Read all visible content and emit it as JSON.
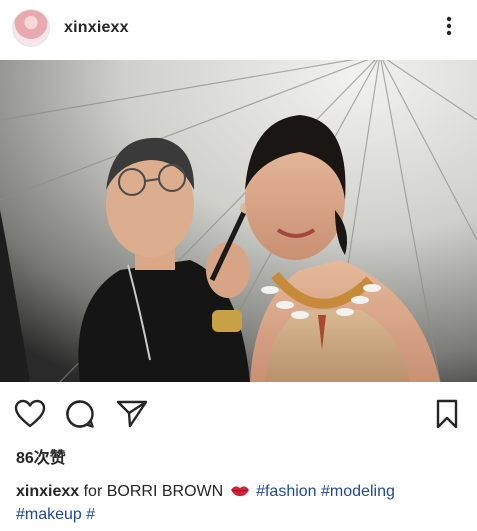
{
  "post": {
    "username": "xinxiexx",
    "likes_count": "86",
    "likes_suffix": "次赞",
    "caption": {
      "username": "xinxiexx",
      "text": "for BORRI BROWN",
      "emoji": "kiss-mark",
      "tags": [
        "#fashion",
        "#modeling",
        "#makeup",
        "#"
      ]
    }
  },
  "icons": {
    "more": "more-horizontal-dots-icon",
    "like": "heart-icon",
    "comment": "comment-bubble-icon",
    "share": "paper-plane-icon",
    "save": "bookmark-icon"
  },
  "colors": {
    "text": "#262626",
    "hashtag": "#1f4a8f",
    "kiss_emoji": "#d2233a"
  }
}
